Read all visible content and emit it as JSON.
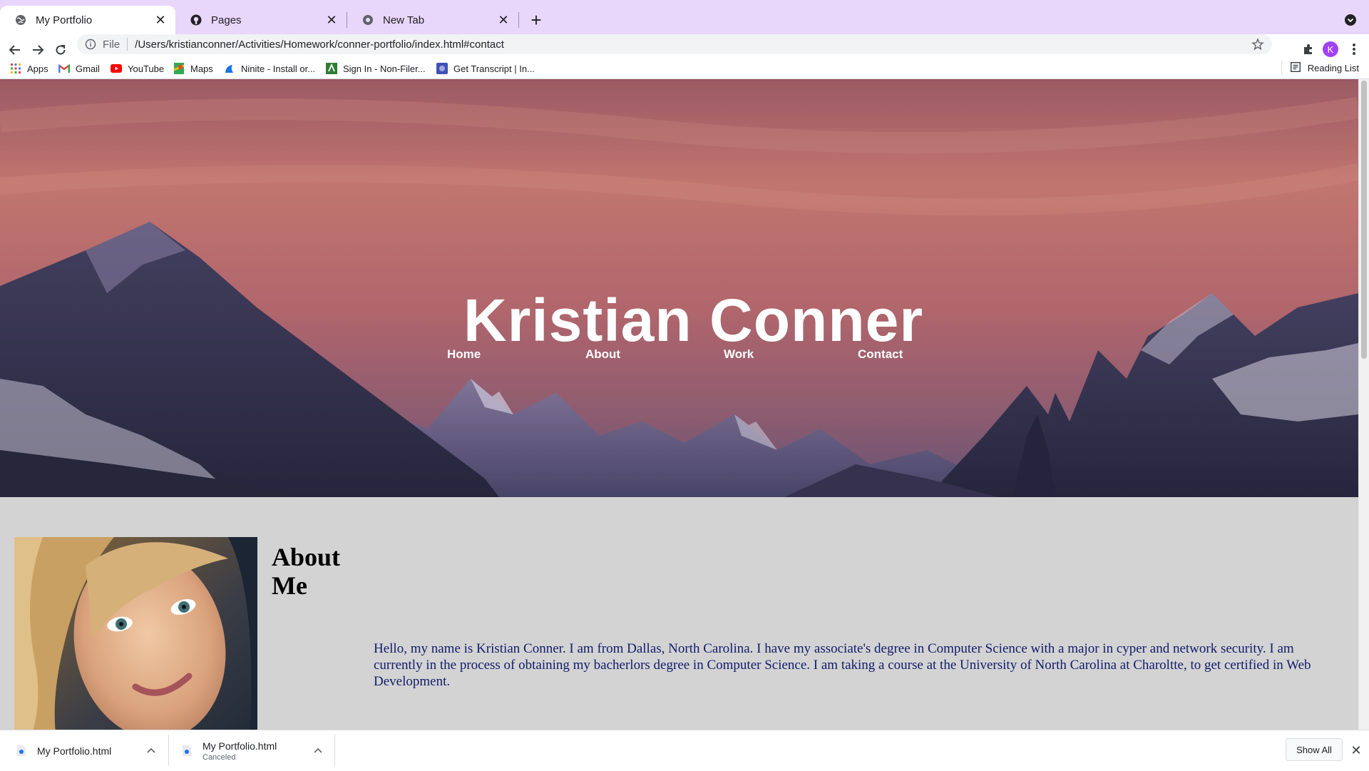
{
  "browser": {
    "tabs": [
      {
        "title": "My Portfolio",
        "icon": "globe-icon",
        "active": true
      },
      {
        "title": "Pages",
        "icon": "github-icon",
        "active": false
      },
      {
        "title": "New Tab",
        "icon": "chrome-icon",
        "active": false
      }
    ],
    "omnibox": {
      "scheme_label": "File",
      "url": "/Users/kristianconner/Activities/Homework/conner-portfolio/index.html#contact"
    },
    "profile_initial": "K",
    "bookmarks": [
      {
        "label": "Apps",
        "icon": "apps-grid-icon"
      },
      {
        "label": "Gmail",
        "icon": "gmail-icon"
      },
      {
        "label": "YouTube",
        "icon": "youtube-icon"
      },
      {
        "label": "Maps",
        "icon": "maps-icon"
      },
      {
        "label": "Ninite - Install or...",
        "icon": "ninite-icon"
      },
      {
        "label": "Sign In - Non-Filer...",
        "icon": "irs-icon"
      },
      {
        "label": "Get Transcript | In...",
        "icon": "transcript-icon"
      }
    ],
    "reading_list": "Reading List"
  },
  "page": {
    "hero": {
      "title": "Kristian Conner",
      "nav": [
        "Home",
        "About",
        "Work",
        "Contact"
      ]
    },
    "about": {
      "heading_line1": "About",
      "heading_line2": "Me",
      "text": "Hello, my name is Kristian Conner. I am from Dallas, North Carolina. I have my associate's degree in Computer Science with a major in cyper and network security. I am currently in the process of obtaining my bacherlors degree in Computer Science. I am taking a course at the University of North Carolina at Charoltte, to get certified in Web Development."
    }
  },
  "downloads": {
    "items": [
      {
        "name": "My Portfolio.html",
        "status": ""
      },
      {
        "name": "My Portfolio.html",
        "status": "Canceled"
      }
    ],
    "show_all": "Show All"
  },
  "colors": {
    "tabstrip": "#e9d6fb",
    "about_bg": "#d3d3d3",
    "about_text": "#111c6b",
    "avatar": "#a142f4"
  }
}
